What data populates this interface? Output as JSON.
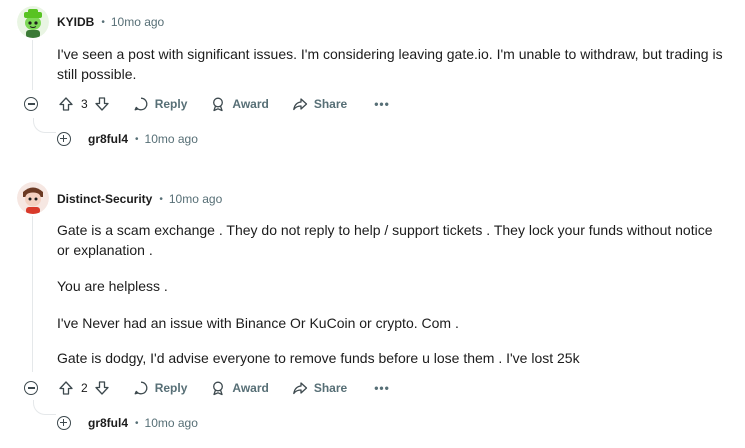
{
  "comments": [
    {
      "username": "KYIDB",
      "time": "10mo ago",
      "paragraphs": [
        "I've seen a post with significant issues. I'm considering leaving gate.io. I'm unable to withdraw, but trading is still possible."
      ],
      "votes": "3",
      "reply_label": "Reply",
      "award_label": "Award",
      "share_label": "Share",
      "more_label": "•••",
      "child": {
        "username": "gr8ful4",
        "time": "10mo ago"
      },
      "avatar_icon": "green-snoo-avatar-icon"
    },
    {
      "username": "Distinct-Security",
      "time": "10mo ago",
      "paragraphs": [
        "Gate is a scam exchange . They do not reply to help / support tickets . They lock your funds without notice or explanation .",
        "You are helpless .",
        "I've Never had an issue with Binance Or KuCoin or crypto. Com .",
        "Gate is dodgy, I'd advise everyone to remove funds before u lose them . I've lost 25k"
      ],
      "votes": "2",
      "reply_label": "Reply",
      "award_label": "Award",
      "share_label": "Share",
      "more_label": "•••",
      "child": {
        "username": "gr8ful4",
        "time": "10mo ago"
      },
      "avatar_icon": "red-snoo-avatar-icon"
    }
  ],
  "separator": "•",
  "colors": {
    "meta_gray": "#576f76",
    "text": "#1c1c1c",
    "thread_line": "#e5e8ea"
  }
}
